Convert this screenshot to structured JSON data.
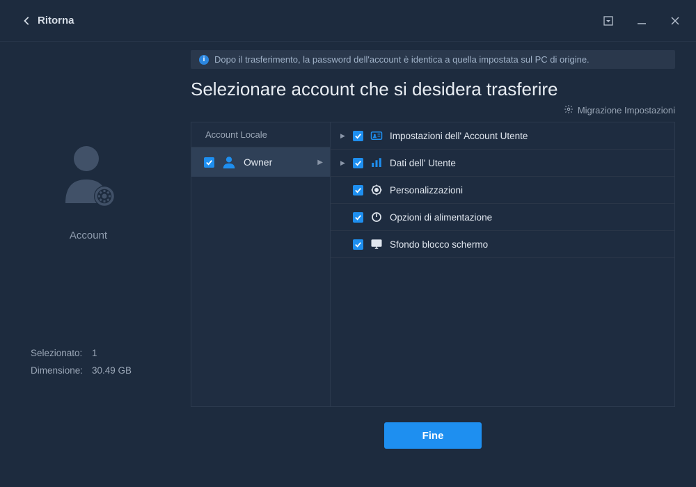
{
  "titlebar": {
    "back_label": "Ritorna"
  },
  "sidebar": {
    "avatar_label": "Account",
    "selected_label": "Selezionato:",
    "selected_value": "1",
    "size_label": "Dimensione:",
    "size_value": "30.49 GB"
  },
  "main": {
    "info_text": "Dopo il trasferimento, la password dell'account è identica a quella impostata sul PC di origine.",
    "title": "Selezionare account che si desidera trasferire",
    "settings_link": "Migrazione Impostazioni",
    "left_header": "Account Locale",
    "account_name": "Owner",
    "settings": [
      {
        "label": "Impostazioni dell' Account Utente",
        "icon": "id-card",
        "expandable": true
      },
      {
        "label": "Dati dell' Utente",
        "icon": "bars",
        "expandable": true
      },
      {
        "label": "Personalizzazioni",
        "icon": "brightness",
        "expandable": false
      },
      {
        "label": "Opzioni di alimentazione",
        "icon": "power",
        "expandable": false
      },
      {
        "label": "Sfondo blocco schermo",
        "icon": "monitor",
        "expandable": false
      }
    ],
    "finish_label": "Fine"
  }
}
